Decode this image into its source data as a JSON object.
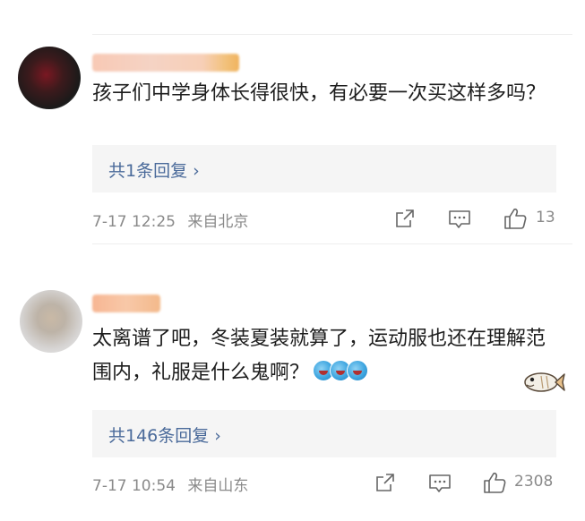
{
  "comments": [
    {
      "text": "孩子们中学身体长得很快，有必要一次买这样多吗？",
      "replies": "共1条回复 ›",
      "time": "7-17 12:25",
      "location": "来自北京",
      "likes": "13"
    },
    {
      "text": "太离谱了吧，冬装夏装就算了，运动服也还在理解范围内，礼服是什么鬼啊？",
      "replies": "共146条回复 ›",
      "time": "7-17 10:54",
      "location": "来自山东",
      "likes": "2308"
    }
  ],
  "icons": [
    "share-icon",
    "comment-icon",
    "like-icon",
    "laugh-emoji-icon",
    "fish-sticker-icon"
  ],
  "colors": {
    "reply_link": "#4a6a9a",
    "meta_gray": "#8a8a8a",
    "reply_bg": "#f5f5f5"
  }
}
